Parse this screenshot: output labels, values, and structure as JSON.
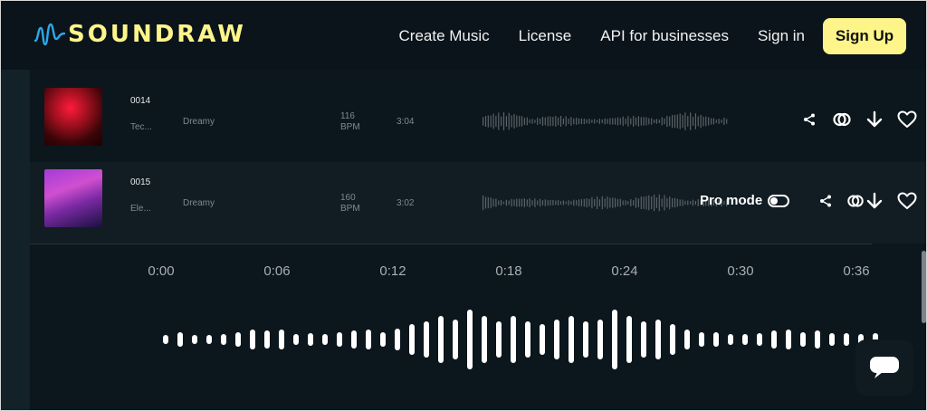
{
  "brand": {
    "name": "SOUNDRAW",
    "color": "#fdf58a"
  },
  "nav": {
    "links": [
      "Create Music",
      "License",
      "API for businesses",
      "Sign in"
    ],
    "signup_label": "Sign Up"
  },
  "tracks": [
    {
      "id": "0014",
      "genre": "Tec...",
      "mood": "Dreamy",
      "bpm_value": "116",
      "bpm_unit": "BPM",
      "duration": "3:04"
    },
    {
      "id": "0015",
      "genre": "Ele...",
      "mood": "Dreamy",
      "bpm_value": "160",
      "bpm_unit": "BPM",
      "duration": "3:02"
    }
  ],
  "pro_mode": {
    "label": "Pro mode",
    "enabled": false
  },
  "player": {
    "time_labels": [
      "0:00",
      "0:06",
      "0:12",
      "0:18",
      "0:24",
      "0:30",
      "0:36"
    ]
  },
  "icons": [
    "share-icon",
    "link-icon",
    "download-icon",
    "heart-icon",
    "chat-icon"
  ]
}
